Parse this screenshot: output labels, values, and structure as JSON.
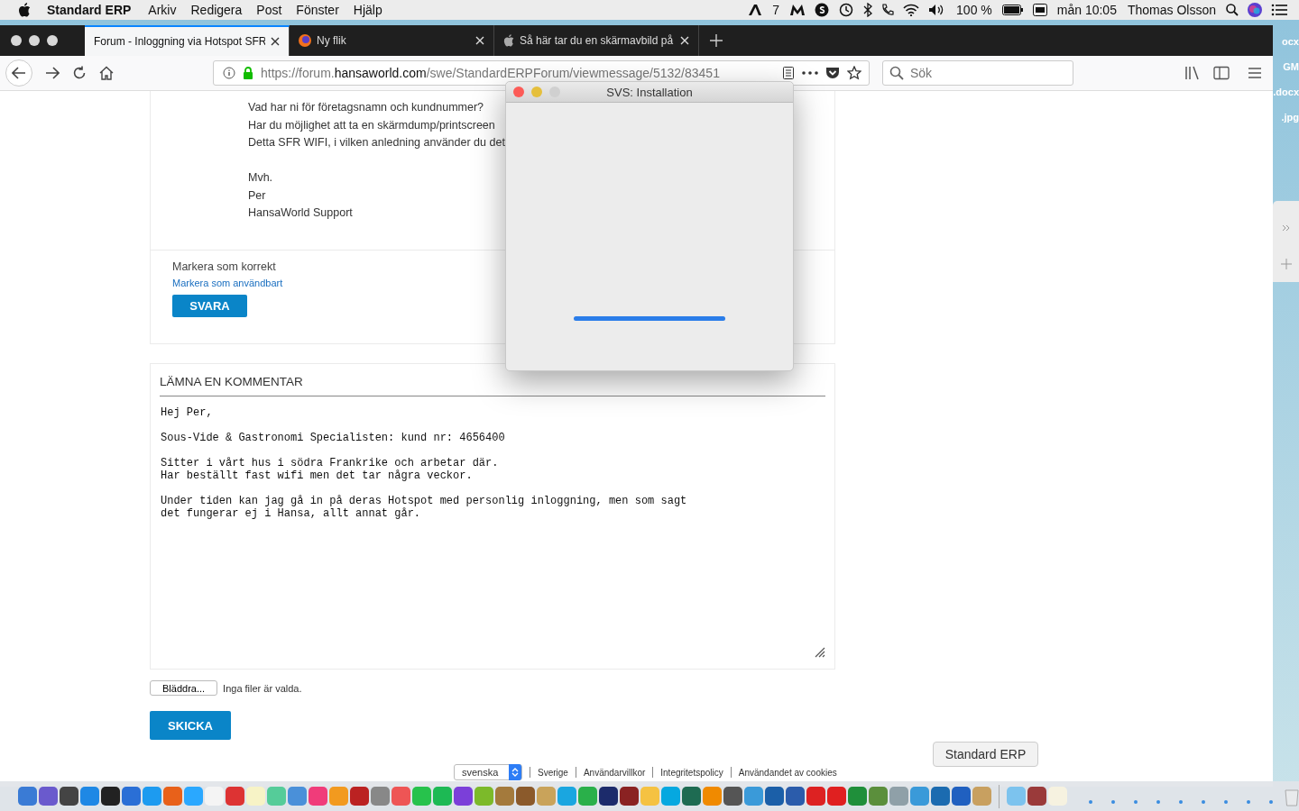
{
  "menu_bar": {
    "app_name": "Standard ERP",
    "items": [
      "Arkiv",
      "Redigera",
      "Post",
      "Fönster",
      "Hjälp"
    ],
    "status": {
      "badge_count": "7",
      "battery": "100 %",
      "clock": "mån 10:05",
      "user": "Thomas Olsson"
    }
  },
  "browser": {
    "tabs": [
      {
        "title": "Forum - Inloggning via Hotspot SFR",
        "selected": true
      },
      {
        "title": "Ny flik",
        "selected": false
      },
      {
        "title": "Så här tar du en skärmavbild på",
        "selected": false
      }
    ],
    "url": {
      "scheme": "https://forum.",
      "domain": "hansaworld.com",
      "path": "/swe/StandardERPForum/viewmessage/5132/83451"
    },
    "search": {
      "placeholder": "Sök"
    }
  },
  "message": {
    "lines": [
      "Vad har ni för företagsnamn och kundnummer?",
      "Har du möjlighet att ta en skärmdump/printscreen",
      "Detta SFR WIFI, i vilken anledning använder du det"
    ],
    "signature": [
      "Mvh.",
      "Per",
      "HansaWorld Support"
    ],
    "mark_correct": "Markera som korrekt",
    "mark_useful": "Markera som användbart",
    "reply_button": "SVARA"
  },
  "comment": {
    "heading": "LÄMNA EN KOMMENTAR",
    "value": "Hej Per,\n\nSous-Vide & Gastronomi Specialisten: kund nr: 4656400\n\nSitter i vårt hus i södra Frankrike och arbetar där.\nHar beställt fast wifi men det tar några veckor.\n\nUnder tiden kan jag gå in på deras Hotspot med personlig inloggning, men som sagt\ndet fungerar ej i Hansa, allt annat går.",
    "browse_button": "Bläddra...",
    "file_status": "Inga filer är valda.",
    "submit_button": "SKICKA"
  },
  "footer": {
    "language": "svenska",
    "links": [
      "Sverige",
      "Användarvillkor",
      "Integritetspolicy",
      "Användandet av cookies"
    ]
  },
  "dialog": {
    "title": "SVS: Installation",
    "progress": {
      "level": 1
    }
  },
  "desktop": {
    "labels": [
      "ocx",
      "GM",
      ".docx",
      ".jpg"
    ]
  },
  "dock": {
    "tooltip": "Standard ERP"
  }
}
